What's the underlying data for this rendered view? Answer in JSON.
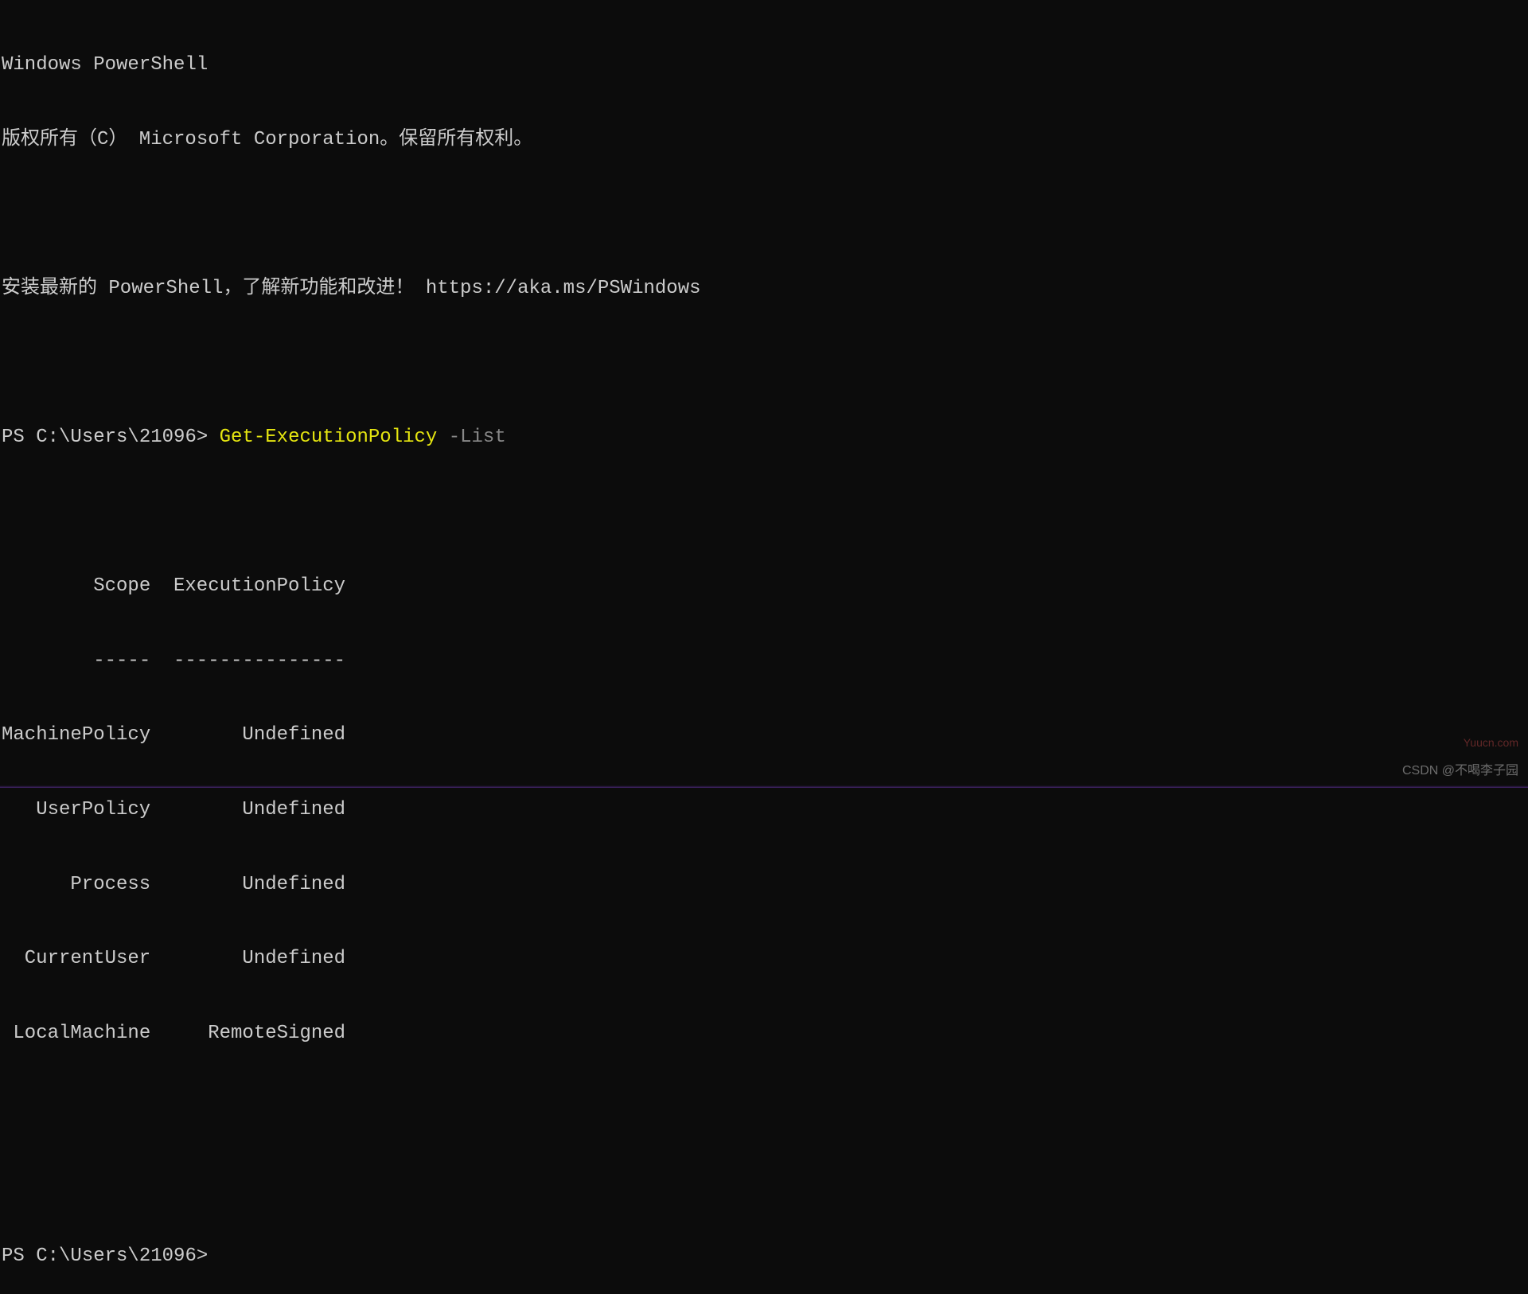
{
  "header": {
    "title": "Windows PowerShell",
    "copyright": "版权所有（C） Microsoft Corporation。保留所有权利。",
    "install_hint_prefix": "安装最新的 PowerShell，了解新功能和改进！",
    "install_hint_url": "https://aka.ms/PSWindows"
  },
  "prompt1": {
    "ps_prefix": "PS C:\\Users\\21096> ",
    "command": "Get-ExecutionPolicy",
    "argument": " -List"
  },
  "table": {
    "headers": {
      "scope": "Scope",
      "policy": "ExecutionPolicy"
    },
    "separator": {
      "scope": "-----",
      "policy": "---------------"
    },
    "rows": [
      {
        "scope": "MachinePolicy",
        "policy": "Undefined"
      },
      {
        "scope": "UserPolicy",
        "policy": "Undefined"
      },
      {
        "scope": "Process",
        "policy": "Undefined"
      },
      {
        "scope": "CurrentUser",
        "policy": "Undefined"
      },
      {
        "scope": "LocalMachine",
        "policy": "RemoteSigned"
      }
    ]
  },
  "prompt2": {
    "ps_prefix": "PS C:\\Users\\21096> "
  },
  "watermarks": {
    "right": "Yuucn.com",
    "bottom": "CSDN @不喝李子园"
  }
}
